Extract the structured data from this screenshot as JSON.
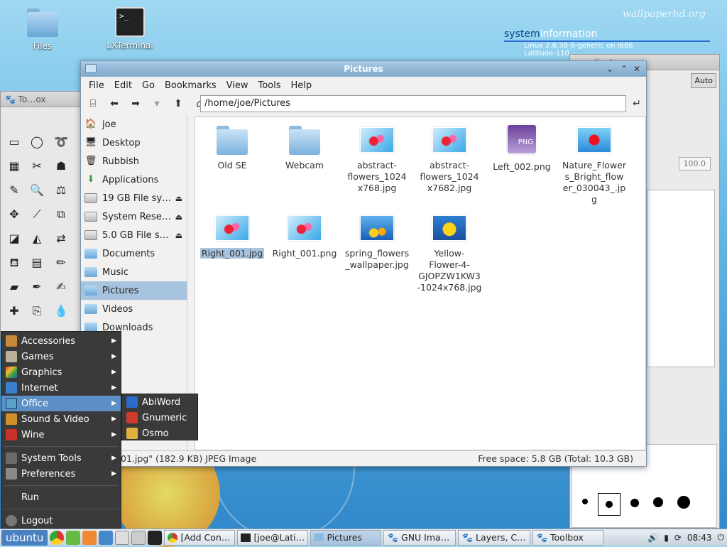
{
  "desktop": {
    "watermark": "wallpaperhd.org",
    "icons": [
      {
        "label": "Files",
        "icon": "folder-icon"
      },
      {
        "label": "LXTerminal",
        "icon": "terminal-icon"
      }
    ],
    "sysinfo": {
      "title_a": "system",
      "title_b": "information",
      "line1": "Linux 2.6.38-8-generic on i686",
      "line2": "Latitude-110"
    }
  },
  "gimp": {
    "toolbox_title": "To…ox",
    "gradients_title": "…radients",
    "auto_label": "Auto",
    "opacity_value": "100.0"
  },
  "window": {
    "title": "Pictures",
    "menu": [
      "File",
      "Edit",
      "Go",
      "Bookmarks",
      "View",
      "Tools",
      "Help"
    ],
    "path": "/home/joe/Pictures",
    "sidebar": [
      {
        "label": "joe",
        "kind": "home"
      },
      {
        "label": "Desktop",
        "kind": "desktop"
      },
      {
        "label": "Rubbish",
        "kind": "trash"
      },
      {
        "label": "Applications",
        "kind": "apps"
      },
      {
        "label": "19 GB File sy…",
        "kind": "drive",
        "eject": true
      },
      {
        "label": "System Rese…",
        "kind": "drive",
        "eject": true
      },
      {
        "label": "5.0 GB File s…",
        "kind": "drive",
        "eject": true
      },
      {
        "label": "Documents",
        "kind": "folder"
      },
      {
        "label": "Music",
        "kind": "folder"
      },
      {
        "label": "Pictures",
        "kind": "folder",
        "selected": true
      },
      {
        "label": "Videos",
        "kind": "folder"
      },
      {
        "label": "Downloads",
        "kind": "folder"
      }
    ],
    "files": [
      {
        "name": "Old SE",
        "type": "folder"
      },
      {
        "name": "Webcam",
        "type": "folder"
      },
      {
        "name": "abstract-flowers_1024x768.jpg",
        "lines": [
          "abstract-",
          "flowers_1024",
          "x768.jpg"
        ],
        "type": "flower1"
      },
      {
        "name": "abstract-flowers_1024x7682.jpg",
        "lines": [
          "abstract-",
          "flowers_1024",
          "x7682.jpg"
        ],
        "type": "flower1"
      },
      {
        "name": "Left_002.png",
        "lines": [
          "Left_002.png"
        ],
        "type": "png"
      },
      {
        "name": "Nature_Flowers_Bright_flower_030043_.jpg",
        "lines": [
          "Nature_Flower",
          "s_Bright_flow",
          "er_030043_.jp",
          "g"
        ],
        "type": "flower2"
      },
      {
        "name": "Right_001.jpg",
        "lines": [
          "Right_001.jpg"
        ],
        "type": "flower1",
        "selected": true
      },
      {
        "name": "Right_001.png",
        "lines": [
          "Right_001.png"
        ],
        "type": "flower1"
      },
      {
        "name": "spring_flowers_wallpaper.jpg",
        "lines": [
          "spring_flowers",
          "_wallpaper.jpg"
        ],
        "type": "spring"
      },
      {
        "name": "Yellow-Flower-4-GJOPZW1KW3-1024x768.jpg",
        "lines": [
          "Yellow-",
          "Flower-4-",
          "GJOPZW1KW3",
          "-1024x768.jpg"
        ],
        "type": "yellow"
      }
    ],
    "status_left": "01.jpg\" (182.9 KB) JPEG Image",
    "status_right": "Free space: 5.8 GB (Total: 10.3 GB)"
  },
  "app_menu": {
    "items": [
      {
        "label": "Accessories",
        "color": "#c98a3a",
        "sub": true
      },
      {
        "label": "Games",
        "color": "#b8b09a",
        "sub": true
      },
      {
        "label": "Graphics",
        "color": "#e0403a",
        "sub": true
      },
      {
        "label": "Internet",
        "color": "#3a7fd0",
        "sub": true
      },
      {
        "label": "Office",
        "color": "#5aa0c8",
        "sub": true,
        "highlight": true
      },
      {
        "label": "Sound & Video",
        "color": "#d0902a",
        "sub": true
      },
      {
        "label": "Wine",
        "color": "#c8322a",
        "sub": true
      }
    ],
    "items2": [
      {
        "label": "System Tools",
        "color": "#6a6a6a",
        "sub": true
      },
      {
        "label": "Preferences",
        "color": "#8a8a8a",
        "sub": true
      }
    ],
    "run": "Run",
    "logout": "Logout",
    "office_sub": [
      {
        "label": "AbiWord",
        "color": "#2a6ac8"
      },
      {
        "label": "Gnumeric",
        "color": "#d03a2a"
      },
      {
        "label": "Osmo",
        "color": "#e0b040"
      }
    ]
  },
  "taskbar": {
    "start": "ubuntu",
    "tasks": [
      {
        "label": "[Add  Con…",
        "icon": "chrome-icon"
      },
      {
        "label": "[joe@Lati…",
        "icon": "terminal-icon"
      },
      {
        "label": "Pictures",
        "icon": "folder-icon",
        "active": true
      },
      {
        "label": "GNU Ima…",
        "icon": "gimp-icon"
      },
      {
        "label": "Layers, C…",
        "icon": "gimp-icon"
      },
      {
        "label": "Toolbox",
        "icon": "gimp-icon"
      }
    ],
    "clock": "08:43"
  }
}
